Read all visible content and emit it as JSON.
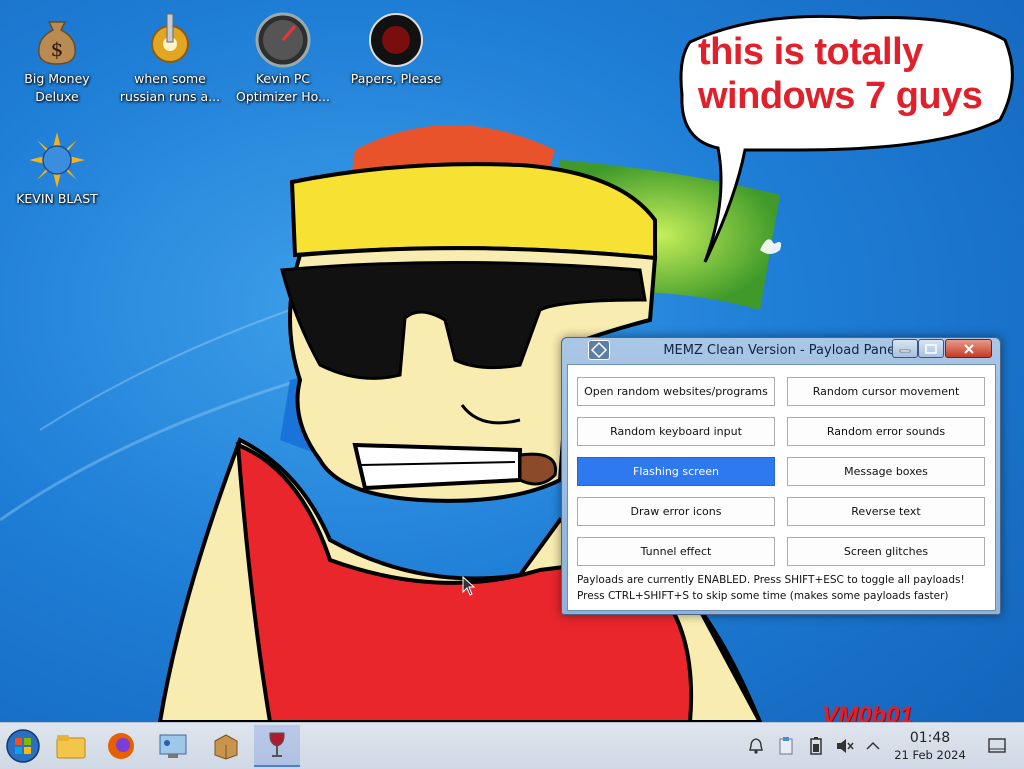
{
  "desktop": {
    "icons": [
      {
        "label": "Big Money\nDeluxe",
        "line1": "Big Money",
        "line2": "Deluxe",
        "icon": "money-bag-icon"
      },
      {
        "label": "when some russian runs a...",
        "line1": "when some",
        "line2": "russian runs a...",
        "icon": "gear-icon"
      },
      {
        "label": "Kevin PC Optimizer Ho...",
        "line1": "Kevin PC",
        "line2": "Optimizer Ho...",
        "icon": "speedometer-icon"
      },
      {
        "label": "Papers, Please",
        "line1": "Papers, Please",
        "line2": "",
        "icon": "papers-please-icon"
      },
      {
        "label": "KEVIN BLAST",
        "line1": "KEVIN BLAST",
        "line2": "",
        "icon": "sun-globe-icon"
      }
    ],
    "speech_bubble": {
      "line1": "this is totally",
      "line2": "windows 7 guys"
    },
    "watermark": "VM0b01"
  },
  "window": {
    "title": "MEMZ Clean Version - Payload Panel",
    "buttons": [
      {
        "label": "Open random websites/programs",
        "active": false
      },
      {
        "label": "Random cursor movement",
        "active": false
      },
      {
        "label": "Random keyboard input",
        "active": false
      },
      {
        "label": "Random error sounds",
        "active": false
      },
      {
        "label": "Flashing screen",
        "active": true
      },
      {
        "label": "Message boxes",
        "active": false
      },
      {
        "label": "Draw error icons",
        "active": false
      },
      {
        "label": "Reverse text",
        "active": false
      },
      {
        "label": "Tunnel effect",
        "active": false
      },
      {
        "label": "Screen glitches",
        "active": false
      }
    ],
    "status_line1": "Payloads are currently ENABLED. Press SHIFT+ESC to toggle all payloads!",
    "status_line2": "Press CTRL+SHIFT+S to skip some time (makes some payloads faster)"
  },
  "taskbar": {
    "start_icon": "start-orb-icon",
    "apps": [
      "folder-icon",
      "firefox-icon",
      "control-panel-icon",
      "package-icon",
      "wine-icon"
    ],
    "tray": [
      "notifications-icon",
      "clipboard-icon",
      "battery-icon",
      "volume-muted-icon",
      "chevron-up-icon"
    ],
    "clock_time": "01:48",
    "clock_date": "21 Feb 2024"
  },
  "colors": {
    "accent": "#2e78f0",
    "bubble_text": "#e0202a",
    "taskbar": "#d8e0ea"
  }
}
